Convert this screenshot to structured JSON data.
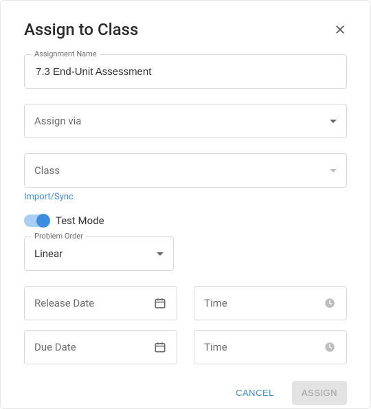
{
  "dialog": {
    "title": "Assign to Class"
  },
  "assignment": {
    "label": "Assignment Name",
    "value": "7.3 End-Unit Assessment"
  },
  "assign_via": {
    "placeholder": "Assign via"
  },
  "class_field": {
    "placeholder": "Class",
    "import_link": "Import/Sync"
  },
  "test_mode": {
    "label": "Test Mode",
    "on": true
  },
  "problem_order": {
    "label": "Problem Order",
    "value": "Linear"
  },
  "release": {
    "date_label": "Release Date",
    "time_label": "Time"
  },
  "due": {
    "date_label": "Due Date",
    "time_label": "Time"
  },
  "actions": {
    "cancel": "CANCEL",
    "assign": "ASSIGN"
  }
}
